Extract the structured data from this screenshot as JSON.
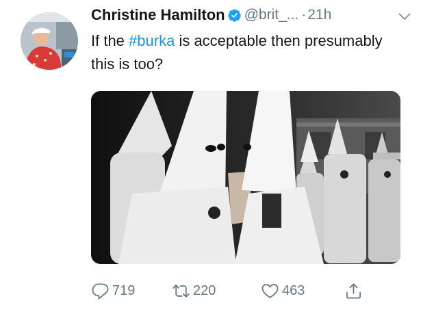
{
  "tweet": {
    "author_name": "Christine Hamilton",
    "handle": "@brit_...",
    "separator": "·",
    "timestamp": "21h",
    "text_prefix": "If the ",
    "hashtag": "#burka",
    "text_suffix": " is acceptable then presumably this is too?",
    "verified": true
  },
  "actions": {
    "reply_count": "719",
    "retweet_count": "220",
    "like_count": "463"
  },
  "icons": {
    "verified": "verified-badge-icon",
    "caret": "chevron-down-icon",
    "reply": "reply-icon",
    "retweet": "retweet-icon",
    "like": "heart-icon",
    "share": "share-icon"
  },
  "colors": {
    "link": "#1b95e0",
    "secondary_text": "#657786",
    "primary_text": "#14171a",
    "verified_badge": "#1da1f2"
  }
}
